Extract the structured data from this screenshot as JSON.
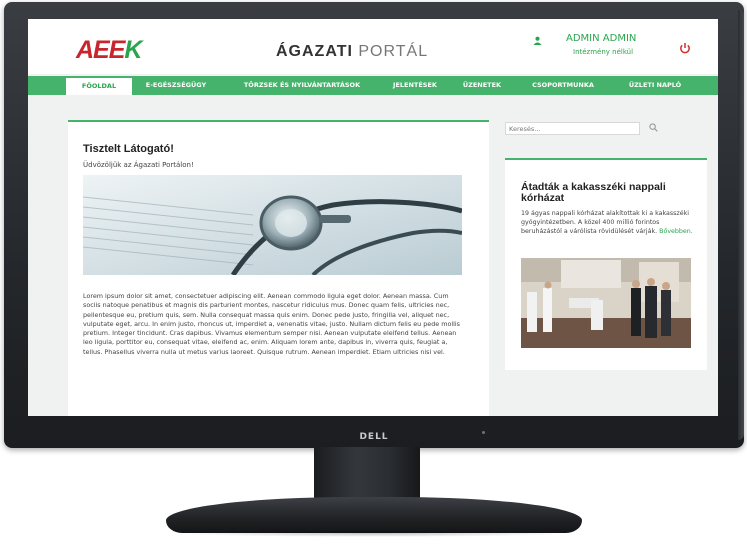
{
  "monitor": {
    "brand": "DELL"
  },
  "header": {
    "logo_main": "AEE",
    "logo_accent": "K",
    "portal_title_bold": "ÁGAZATI",
    "portal_title_light": "PORTÁL",
    "user_name": "ADMIN ADMIN",
    "user_institution": "Intézmény nélkül",
    "user_icon": "user-icon",
    "power_icon": "power-icon"
  },
  "nav": {
    "items": [
      {
        "label": "FŐOLDAL",
        "active": true
      },
      {
        "label": "E-EGÉSZSÉGÜGY"
      },
      {
        "label": "TÖRZSEK ÉS NYILVÁNTARTÁSOK"
      },
      {
        "label": "JELENTÉSEK"
      },
      {
        "label": "ÜZENETEK"
      },
      {
        "label": "CSOPORTMUNKA"
      },
      {
        "label": "ÜZLETI NAPLÓ"
      }
    ]
  },
  "main": {
    "greeting_title": "Tisztelt Látogató!",
    "greeting_sub": "Üdvözöljük az Ágazati Portálon!",
    "body_text": "Lorem ipsum dolor sit amet, consectetuer adipiscing elit. Aenean commodo ligula eget dolor. Aenean massa. Cum sociis natoque penatibus et magnis dis parturient montes, nascetur ridiculus mus. Donec quam felis, ultricies nec, pellentesque eu, pretium quis, sem. Nulla consequat massa quis enim. Donec pede justo, fringilla vel, aliquet nec, vulputate eget, arcu. In enim justo, rhoncus ut, imperdiet a, venenatis vitae, justo. Nullam dictum felis eu pede mollis pretium. Integer tincidunt. Cras dapibus. Vivamus elementum semper nisi. Aenean vulputate eleifend tellus. Aenean leo ligula, porttitor eu, consequat vitae, eleifend ac, enim. Aliquam lorem ante, dapibus in, viverra quis, feugiat a, tellus. Phasellus viverra nulla ut metus varius laoreet. Quisque rutrum. Aenean imperdiet. Etiam ultricies nisi vel."
  },
  "sidebar": {
    "search_placeholder": "Keresés...",
    "search_icon": "search-icon",
    "news_title": "Átadták a kakasszéki nappali kórházat",
    "news_text": "19 ágyas nappali kórházat alakítottak ki a kakasszéki gyógyintézetben. A közel 400 millió forintos beruházástól a várólista rövidülését várják.",
    "news_link": "Bővebben."
  },
  "colors": {
    "accent": "#45b36b",
    "logo_red": "#c8262e",
    "power": "#d0302b"
  }
}
